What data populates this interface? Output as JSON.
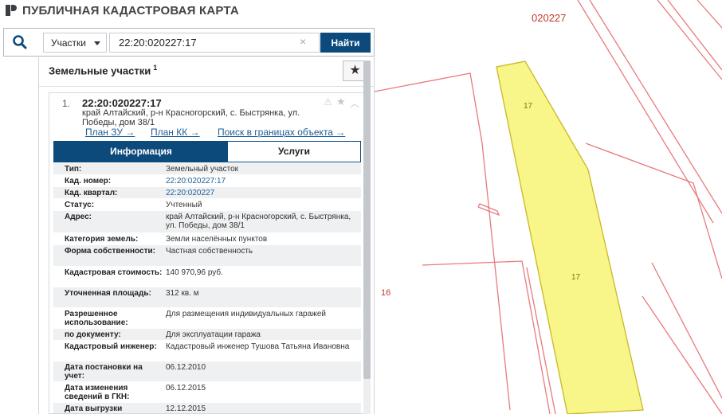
{
  "app": {
    "title": "ПУБЛИЧНАЯ КАДАСТРОВАЯ КАРТА"
  },
  "search": {
    "type_selected": "Участки",
    "query": "22:20:020227:17",
    "clear_glyph": "×",
    "button": "Найти"
  },
  "panel": {
    "title": "Земельные участки",
    "count": "1"
  },
  "card": {
    "index": "1.",
    "id": "22:20:020227:17",
    "address": "край Алтайский, р-н Красногорский, с. Быстрянка, ул. Победы, дом 38/1",
    "links": [
      "План ЗУ →",
      "План КК →",
      "Поиск в границах объекта →"
    ],
    "tabs": {
      "info": "Информация",
      "services": "Услуги",
      "active": "info"
    }
  },
  "details": [
    {
      "key": "Тип:",
      "value": "Земельный участок",
      "link": false,
      "h": 15
    },
    {
      "key": "Кад. номер:",
      "value": "22:20:020227:17",
      "link": true,
      "h": 15
    },
    {
      "key": "Кад. квартал:",
      "value": "22:20:020227",
      "link": true,
      "h": 15
    },
    {
      "key": "Статус:",
      "value": "Учтенный",
      "link": false,
      "h": 15
    },
    {
      "key": "Адрес:",
      "value": "край Алтайский, р-н Красногорский, с. Быстрянка, ул. Победы, дом 38/1",
      "link": false,
      "h": 28
    },
    {
      "key": "Категория земель:",
      "value": "Земли населённых пунктов",
      "link": false,
      "h": 15
    },
    {
      "key": "Форма собственности:",
      "value": "Частная собственность",
      "link": false,
      "h": 27
    },
    {
      "key": "Кадастровая стоимость:",
      "value": "140 970,96 руб.",
      "link": false,
      "h": 26
    },
    {
      "key": "Уточненная площадь:",
      "value": "312 кв. м",
      "link": false,
      "h": 26
    },
    {
      "key": "Разрешенное использование:",
      "value": "Для размещения индивидуальных гаражей",
      "link": false,
      "h": 26
    },
    {
      "key": "по документу:",
      "value": "Для эксплуатации гаража",
      "link": false,
      "h": 15
    },
    {
      "key": "Кадастровый инженер:",
      "value": "Кадастровый инженер Тушова Татьяна Ивановна",
      "link": false,
      "h": 26
    },
    {
      "key": "Дата постановки на учет:",
      "value": "06.12.2010",
      "link": false,
      "h": 26
    },
    {
      "key": "Дата изменения сведений в ГКН:",
      "value": "06.12.2015",
      "link": false,
      "h": 26
    },
    {
      "key": "Дата выгрузки",
      "value": "12.12.2015",
      "link": false,
      "h": 20
    }
  ],
  "map": {
    "labels": {
      "block": "020227",
      "parcel_top": "17",
      "parcel_mid": "17",
      "left_parcel": "16"
    },
    "colors": {
      "boundary": "#e0484a",
      "parcel_fill": "#f8f589",
      "parcel_stroke": "#c9b825",
      "accent": "#0d4a7c"
    }
  }
}
